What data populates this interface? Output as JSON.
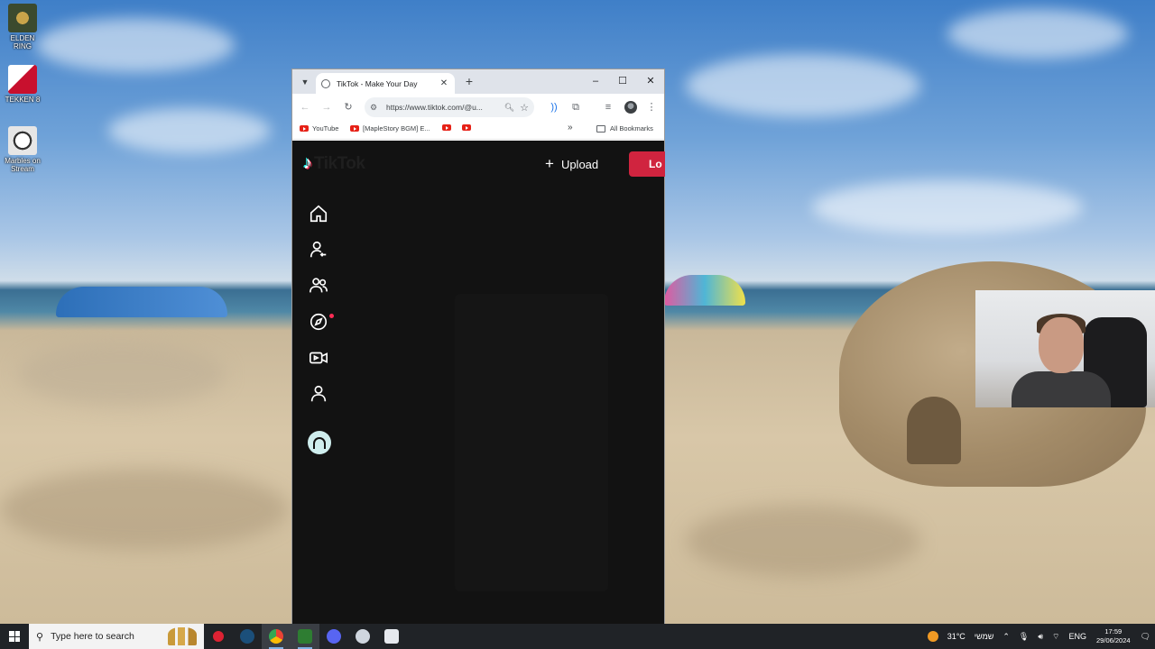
{
  "desktop": {
    "icons": [
      {
        "label": "ELDEN RING",
        "icon": "elden-ring-icon",
        "color": "#3b4a2e"
      },
      {
        "label": "TEKKEN 8",
        "icon": "tekken-icon",
        "color": "#c8102e"
      },
      {
        "label": "Marbles on Stream",
        "icon": "marbles-icon",
        "color": "#d9d9d9"
      }
    ]
  },
  "browser": {
    "tab_title": "TikTok - Make Your Day",
    "tab_list_icon": "chevron-down-icon",
    "new_tab": "+",
    "window_controls": {
      "minimize": "–",
      "maximize": "☐",
      "close": "✕"
    },
    "url": "https://www.tiktok.com/@u...",
    "bookmarks": [
      {
        "label": "YouTube",
        "icon": "youtube-icon"
      },
      {
        "label": "[MapleStory BGM] E...",
        "icon": "youtube-icon"
      },
      {
        "label": "",
        "icon": "youtube-icon"
      },
      {
        "label": "",
        "icon": "youtube-icon"
      }
    ],
    "more_bookmarks": "»",
    "all_bookmarks": "All Bookmarks"
  },
  "tiktok": {
    "logo_text": "TikTok",
    "upload_label": "Upload",
    "login_label": "Lo",
    "accent": "#fe2c55",
    "nav": [
      "home-icon",
      "following-icon",
      "friends-icon",
      "explore-icon",
      "live-icon",
      "profile-icon"
    ]
  },
  "taskbar": {
    "search_placeholder": "Type here to search",
    "weather": "31°C",
    "weather_desc": "שמשי",
    "language": "ENG",
    "time": "17:59",
    "date": "29/06/2024"
  }
}
